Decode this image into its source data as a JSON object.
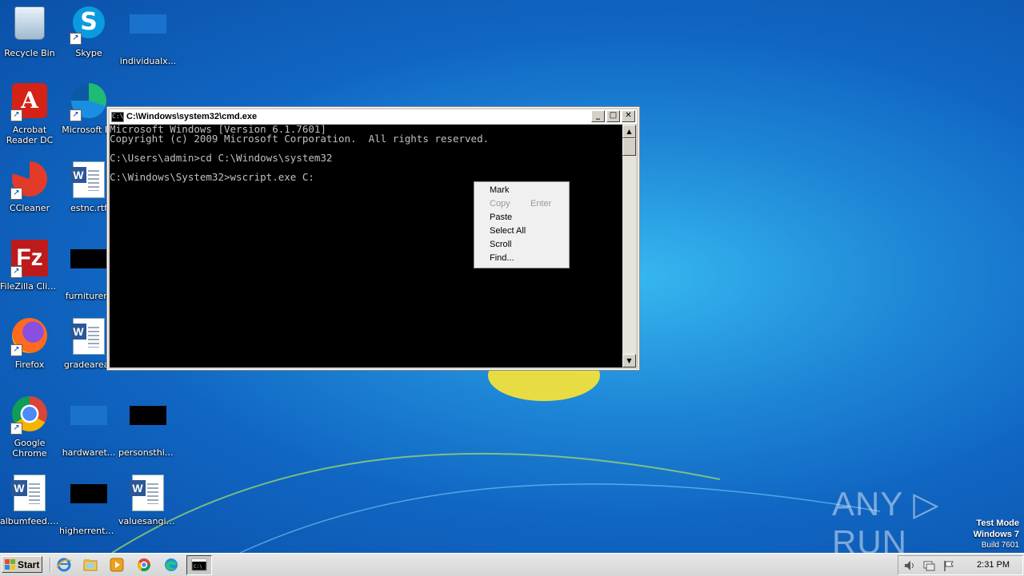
{
  "desktop": {
    "icons": [
      {
        "label": "Recycle Bin"
      },
      {
        "label": "Skype"
      },
      {
        "label": "individualx..."
      },
      {
        "label": "Acrobat Reader DC"
      },
      {
        "label": "Microsoft Ed"
      },
      {
        "label": "CCleaner"
      },
      {
        "label": "estnc.rtf"
      },
      {
        "label": "FileZilla Client"
      },
      {
        "label": "furniturere"
      },
      {
        "label": "Firefox"
      },
      {
        "label": "gradeareas"
      },
      {
        "label": "Google Chrome"
      },
      {
        "label": "hardwaret..."
      },
      {
        "label": "personsthin..."
      },
      {
        "label": "albumfeed.rtf"
      },
      {
        "label": "higherrental..."
      },
      {
        "label": "valuesangin..."
      }
    ]
  },
  "cmd_window": {
    "title": "C:\\Windows\\system32\\cmd.exe",
    "icon_text": "C:\\",
    "buttons": {
      "minimize": "_",
      "maximize": "□",
      "close": "✕"
    },
    "lines": [
      "Microsoft Windows [Version 6.1.7601]",
      "Copyright (c) 2009 Microsoft Corporation.  All rights reserved.",
      "",
      "C:\\Users\\admin>cd C:\\Windows\\system32",
      "",
      "C:\\Windows\\System32>wscript.exe C:"
    ]
  },
  "context_menu": {
    "items": [
      {
        "label": "Mark",
        "shortcut": "",
        "enabled": true
      },
      {
        "label": "Copy",
        "shortcut": "Enter",
        "enabled": false
      },
      {
        "label": "Paste",
        "shortcut": "",
        "enabled": true
      },
      {
        "label": "Select All",
        "shortcut": "",
        "enabled": true
      },
      {
        "label": "Scroll",
        "shortcut": "",
        "enabled": true
      },
      {
        "label": "Find...",
        "shortcut": "",
        "enabled": true
      }
    ]
  },
  "watermark": {
    "text": "ANY ▷ RUN",
    "os_line1": "Test Mode",
    "os_line2": "Windows 7",
    "os_line3": "Build 7601"
  },
  "taskbar": {
    "start_label": "Start",
    "clock": "2:31 PM"
  }
}
